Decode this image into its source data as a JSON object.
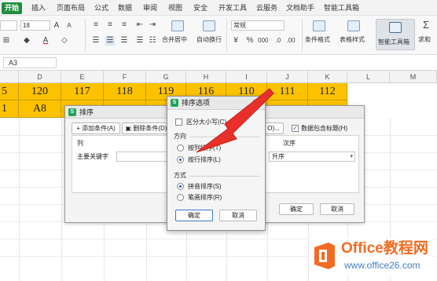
{
  "menubar": {
    "tabs": [
      "开始",
      "插入",
      "页面布局",
      "公式",
      "数据",
      "审阅",
      "视图",
      "安全",
      "开发工具",
      "云服务",
      "文档助手",
      "智能工具箱"
    ],
    "active_tab": "开始"
  },
  "toolbar": {
    "font_size": "18",
    "number_format": "常规",
    "merge_center": "合并居中",
    "auto_wrap": "自动换行",
    "conditional_format": "条件格式",
    "table_style": "表格样式",
    "smart_toolbox": "智能工具箱",
    "sum": "求和"
  },
  "formula_bar": {
    "name_box": "A3"
  },
  "grid": {
    "columns": [
      "D",
      "E",
      "F",
      "G",
      "H",
      "I",
      "J",
      "K",
      "L",
      "M"
    ],
    "row1": [
      "5",
      "120",
      "117",
      "118",
      "119",
      "116",
      "110",
      "111",
      "112"
    ],
    "row2": [
      "1",
      "A8",
      "",
      "",
      "",
      "",
      "",
      "",
      ""
    ]
  },
  "sort_dialog": {
    "title": "排序",
    "add_condition": "添加条件(A)",
    "delete_condition": "删除条件(D)",
    "options_button": "O)...",
    "has_header_label": "数据包含标题(H)",
    "has_header_checked": true,
    "column_header": "列",
    "order_header": "次序",
    "primary_key_label": "主要关键字",
    "order_value": "升序",
    "ok": "确定",
    "cancel": "取消"
  },
  "options_dialog": {
    "title": "排序选项",
    "case_sensitive": "区分大小写(C)",
    "direction_label": "方向",
    "by_column": "按列排序(T)",
    "by_row": "按行排序(L)",
    "method_label": "方式",
    "pinyin": "拼音排序(S)",
    "stroke": "笔画排序(R)",
    "selected_direction": "by_row",
    "selected_method": "pinyin",
    "ok": "确定",
    "cancel": "取消"
  },
  "colors": {
    "accent_green": "#1e8e3e",
    "cell_gold": "#fcc200",
    "arrow_red": "#e8302a",
    "watermark_orange": "#f26b21"
  },
  "watermark": {
    "title": "Office教程网",
    "url": "www.office26.com"
  }
}
